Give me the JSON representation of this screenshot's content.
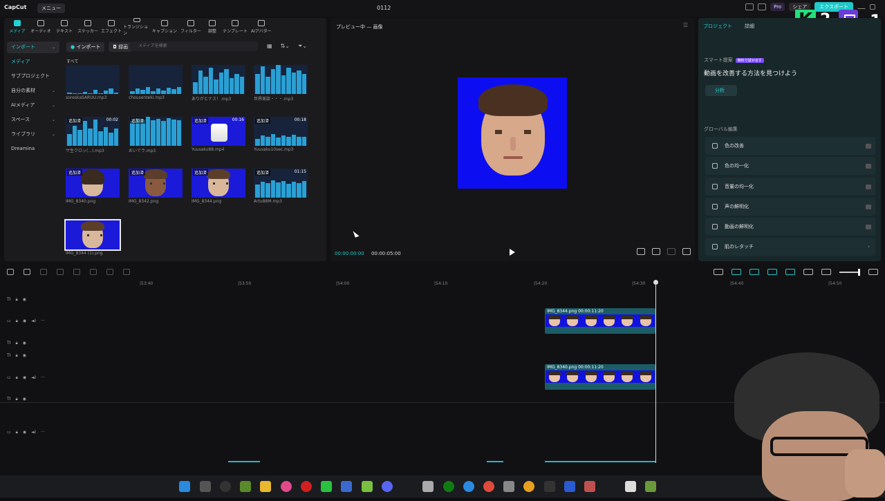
{
  "app": {
    "logo": "CapCut",
    "menu": "メニュー",
    "title": "0112",
    "pro": "Pro",
    "share": "シェア",
    "export": "エクスポート"
  },
  "overlay": {
    "k_num": "2",
    "t_num": "1"
  },
  "toolbar": [
    "メディア",
    "オーディオ",
    "テキスト",
    "ステッカー",
    "エフェクト",
    "トランジション",
    "キャプション",
    "フィルター",
    "調整",
    "テンプレート",
    "AIアバター"
  ],
  "sidebar": [
    "インポート",
    "メディア",
    "サブプロジェクト",
    "自分の素材",
    "AIメディア",
    "スペース",
    "ライブラリ",
    "Dreamina"
  ],
  "media": {
    "import_label": "インポート",
    "record_label": "録画",
    "search_placeholder": "メディアを検索",
    "all_label": "すべて",
    "items": [
      {
        "name": "soreskaSARUU.mp3",
        "added": "",
        "dur": ""
      },
      {
        "name": "chousenteki.mp3",
        "added": "",
        "dur": ""
      },
      {
        "name": "ありがとナス！.mp3",
        "added": "",
        "dur": ""
      },
      {
        "name": "世界美談・・・.mp3",
        "added": "",
        "dur": ""
      },
      {
        "name": "サ生クロッ(...).mp3",
        "added": "追加済",
        "dur": "00:02"
      },
      {
        "name": "おいでラ.mp3",
        "added": "追加済",
        "dur": ""
      },
      {
        "name": "Yuusaku88.mp4",
        "added": "追加済",
        "dur": "00:16"
      },
      {
        "name": "Yuusaku10sec.mp3",
        "added": "追加済",
        "dur": "00:18"
      },
      {
        "name": "IMG_8340.png",
        "added": "追加済",
        "dur": ""
      },
      {
        "name": "IMG_8342.png",
        "added": "追加済",
        "dur": ""
      },
      {
        "name": "IMG_8344.png",
        "added": "追加済",
        "dur": ""
      },
      {
        "name": "Artu88M.mp3",
        "added": "追加済",
        "dur": "01:15"
      },
      {
        "name": "IMG_8344 (1).png",
        "added": "",
        "dur": ""
      }
    ]
  },
  "preview": {
    "title": "プレビュー中 — 画像",
    "current_time": "00:00:00:00",
    "total_time": "00:00:05:00"
  },
  "right_panel": {
    "tabs": [
      "プロジェクト",
      "詳細"
    ],
    "smart_label": "スマート提案",
    "smart_badge": "無料で試せます",
    "smart_heading": "動画を改善する方法を見つけよう",
    "analyze": "分析",
    "global_label": "グローバル編集",
    "features": [
      "色の改善",
      "色の均一化",
      "音量の均一化",
      "声の鮮明化",
      "動画の鮮明化",
      "肌のレタッチ"
    ]
  },
  "timeline": {
    "ruler": [
      "|53:40",
      "|53:50",
      "|54:00",
      "|54:10",
      "|54:20",
      "|54:30",
      "|54:40",
      "|54:50"
    ],
    "clips": [
      {
        "label": "IMG_8344.png  00:00:11:20"
      },
      {
        "label": "IMG_8340.png  00:00:11:20"
      }
    ]
  }
}
